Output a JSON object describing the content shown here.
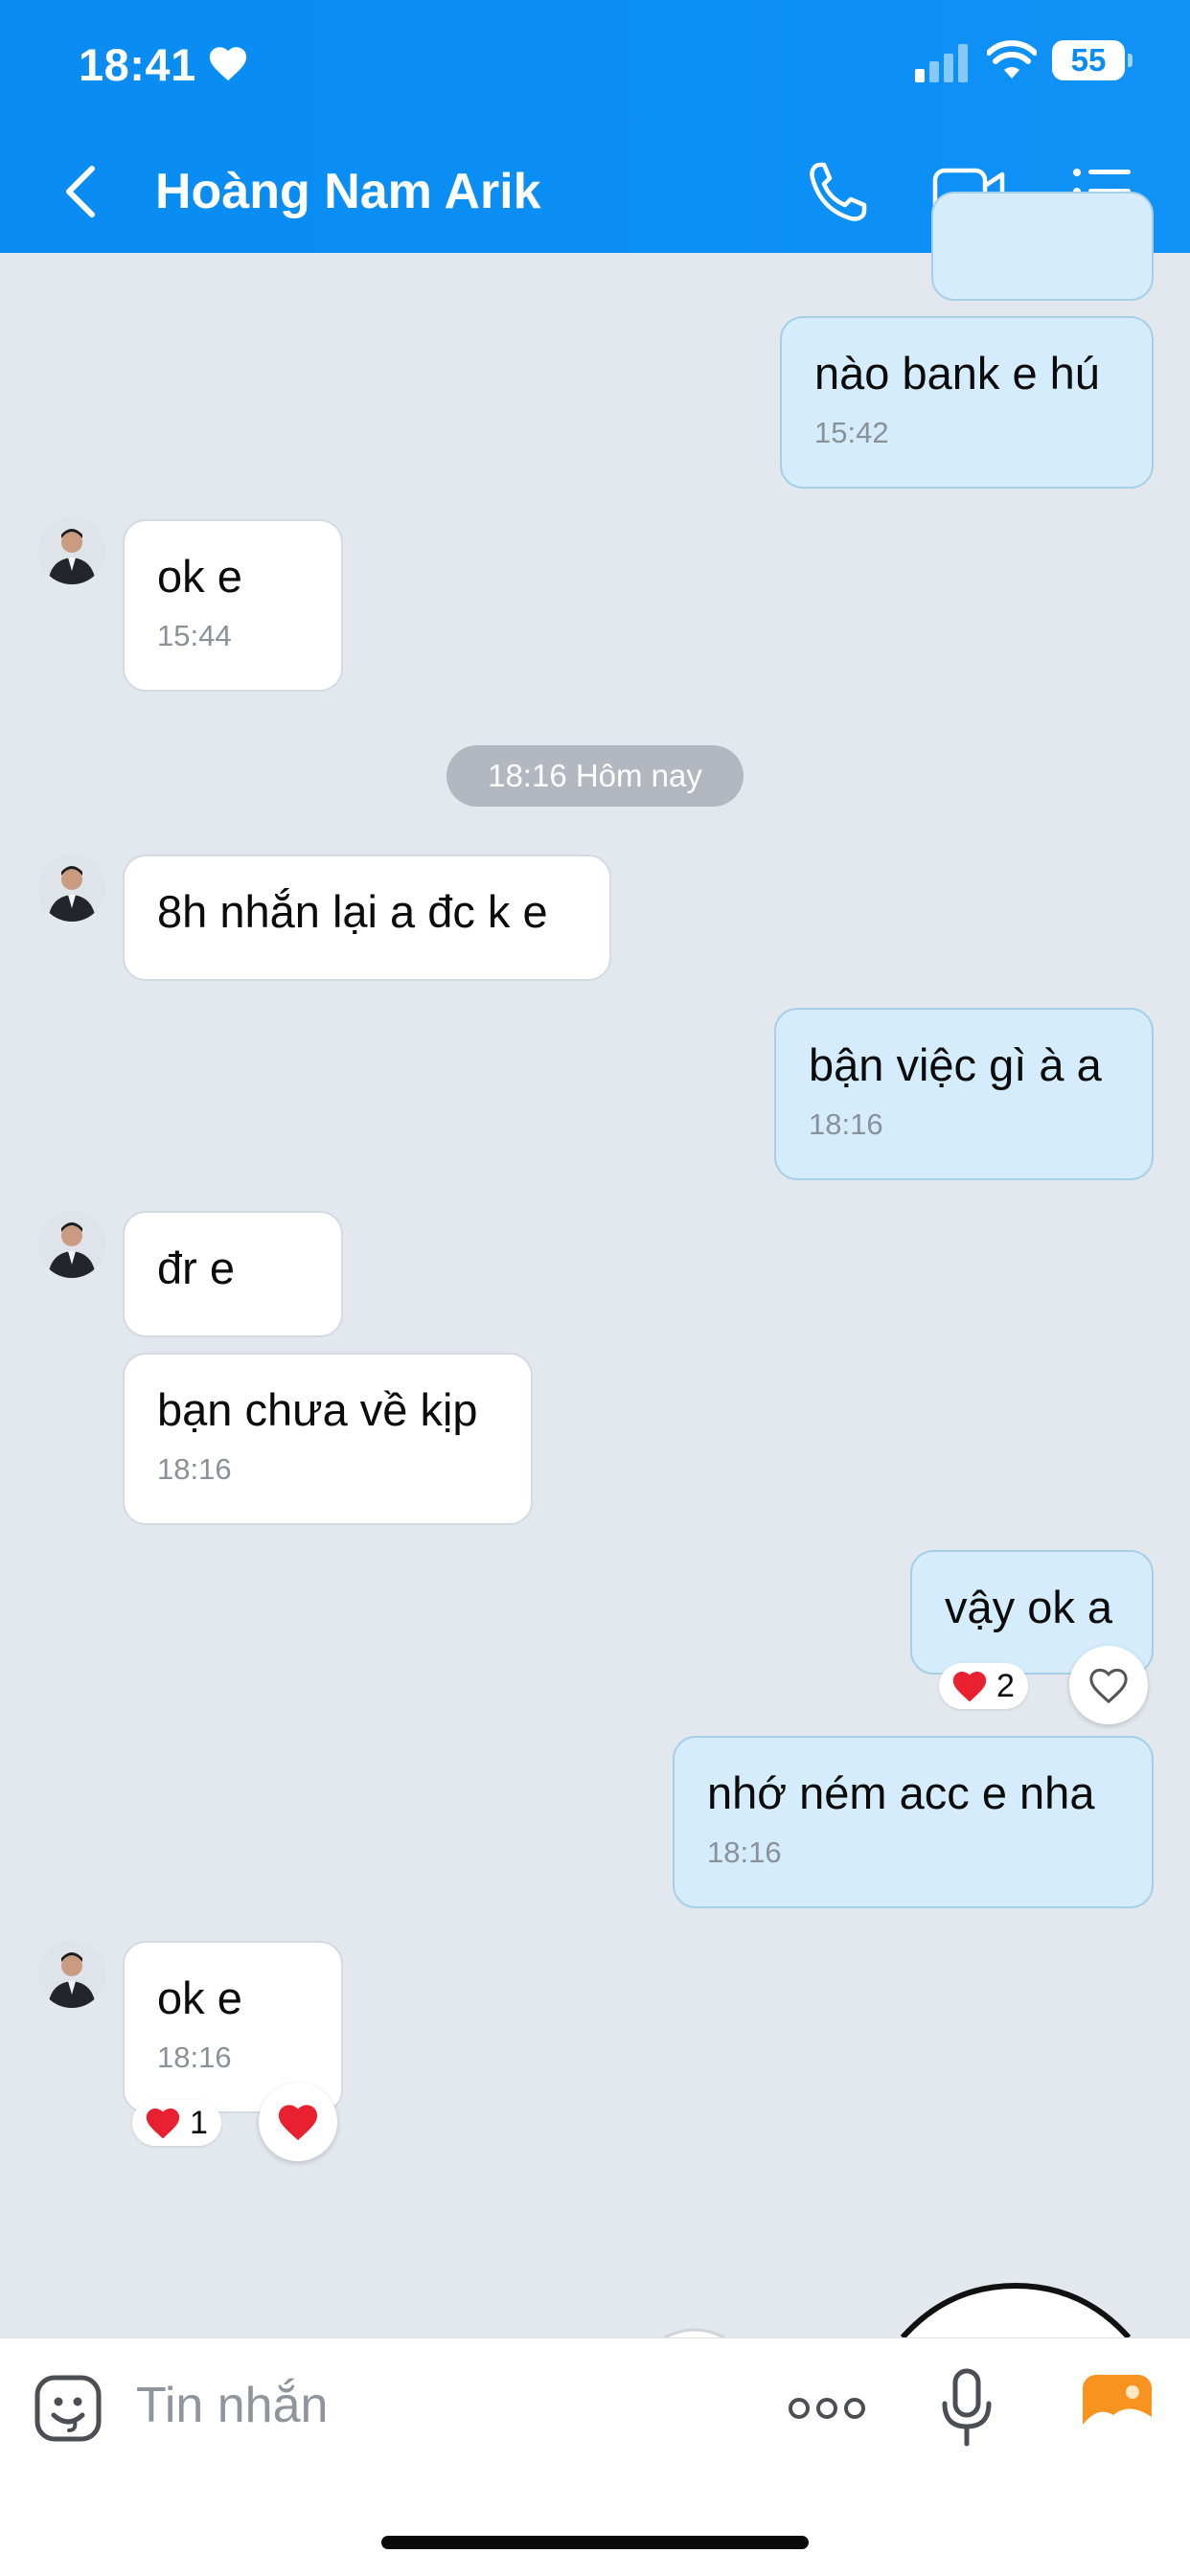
{
  "status_bar": {
    "time": "18:41",
    "battery": "55"
  },
  "header": {
    "title": "Hoàng Nam Arik"
  },
  "date_separator": "18:16 Hôm nay",
  "messages": [
    {
      "text": "nào bank e hú",
      "time": "15:42"
    },
    {
      "text": "ok e",
      "time": "15:44"
    },
    {
      "text": "8h nhắn lại a đc k e"
    },
    {
      "text": "bận việc gì à a",
      "time": "18:16"
    },
    {
      "text": "đr e"
    },
    {
      "text": "bạn chưa về kịp",
      "time": "18:16"
    },
    {
      "text": "vậy ok a",
      "reaction_count": "2"
    },
    {
      "text": "nhớ ném acc e nha",
      "time": "18:16"
    },
    {
      "text": "ok e",
      "time": "18:16",
      "reaction_count": "1"
    }
  ],
  "composer": {
    "placeholder": "Tin nhắn"
  },
  "colors": {
    "header_blue": "#0a8cf2",
    "outgoing_bubble": "#d4ecfb",
    "incoming_bubble": "#ffffff",
    "chat_background": "#e3e8ef",
    "reaction_heart": "#e8202f"
  },
  "icons": [
    "heart-icon",
    "signal-icon",
    "wifi-icon",
    "back-arrow-icon",
    "phone-icon",
    "video-call-icon",
    "menu-list-icon",
    "sticker-icon",
    "more-dots-icon",
    "microphone-icon",
    "photo-gallery-icon"
  ]
}
